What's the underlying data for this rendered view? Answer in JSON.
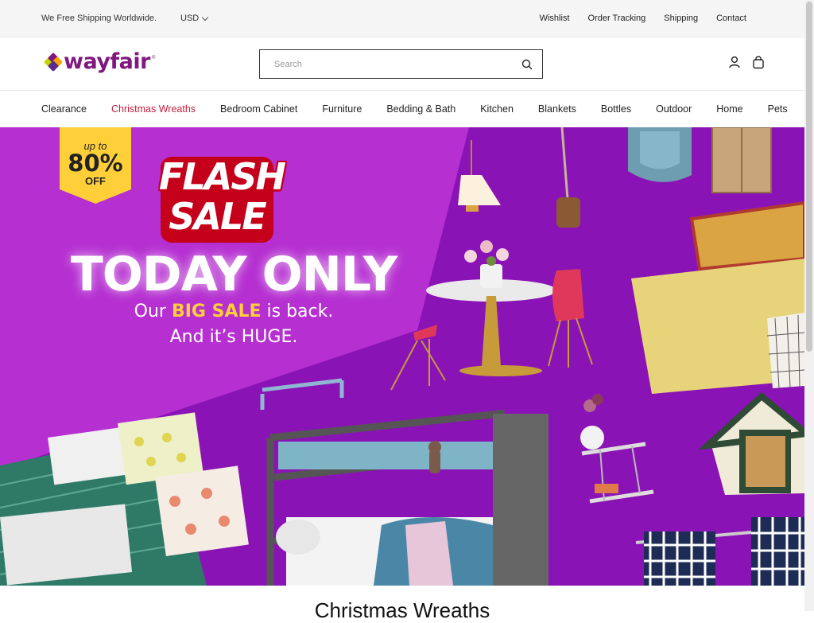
{
  "topbar": {
    "shipping_text": "We Free Shipping Worldwide.",
    "currency": "USD",
    "links": [
      "Wishlist",
      "Order Tracking",
      "Shipping",
      "Contact"
    ]
  },
  "header": {
    "logo_text": "wayfair",
    "search_placeholder": "Search"
  },
  "nav": {
    "items": [
      "Clearance",
      "Christmas Wreaths",
      "Bedroom Cabinet",
      "Furniture",
      "Bedding & Bath",
      "Kitchen",
      "Blankets",
      "Bottles",
      "Outdoor",
      "Home",
      "Pets"
    ]
  },
  "hero": {
    "badge_upto": "up to",
    "badge_percent": "80%",
    "badge_off": "OFF",
    "flash_line1": "FLASH",
    "flash_line2": "SALE",
    "headline": "TODAY ONLY",
    "sub_before": "Our ",
    "sub_highlight": "BIG SALE",
    "sub_after": " is back.",
    "sub_line2": "And it’s HUGE."
  },
  "section": {
    "title": "Christmas Wreaths"
  },
  "colors": {
    "brand_purple": "#7f187f",
    "hero_purple": "#8a13b5",
    "hero_light_purple": "#b52fd1",
    "nav_active_red": "#c41e3a",
    "badge_yellow": "#ffcf3a"
  }
}
